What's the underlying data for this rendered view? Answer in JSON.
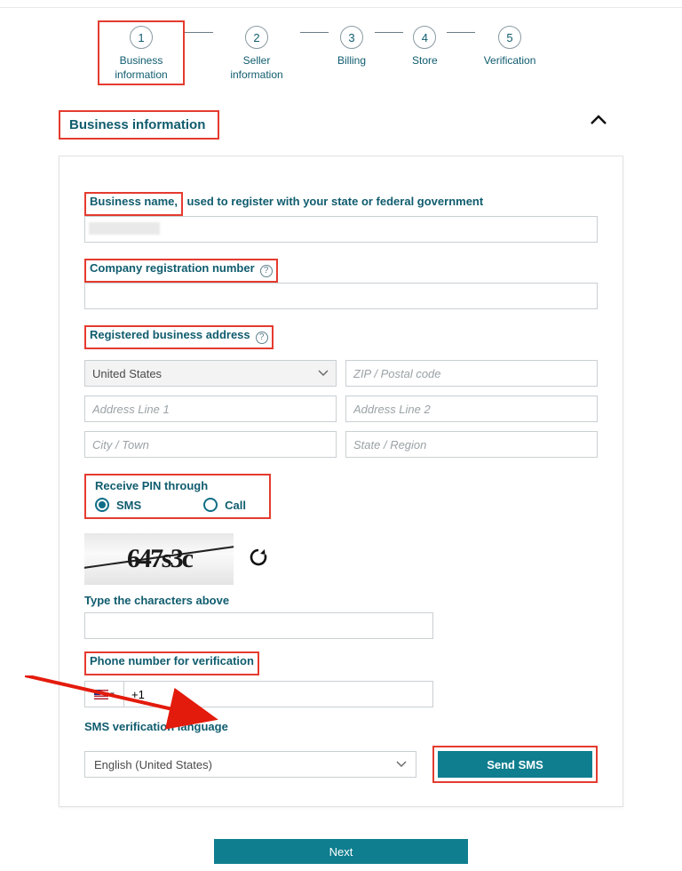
{
  "wizard": {
    "steps": [
      {
        "num": "1",
        "label": "Business information"
      },
      {
        "num": "2",
        "label": "Seller information"
      },
      {
        "num": "3",
        "label": "Billing"
      },
      {
        "num": "4",
        "label": "Store"
      },
      {
        "num": "5",
        "label": "Verification"
      }
    ]
  },
  "section_title": "Business information",
  "labels": {
    "business_name_boxed": "Business name,",
    "business_name_rest": " used to register with your state or federal government",
    "company_reg": "Company registration number",
    "reg_addr": "Registered business address",
    "captcha_prompt": "Type the characters above",
    "phone_verif": "Phone number for verification",
    "sms_lang": "SMS verification language"
  },
  "address": {
    "country": "United States",
    "placeholders": {
      "zip": "ZIP / Postal code",
      "line1": "Address Line 1",
      "line2": "Address Line 2",
      "city": "City / Town",
      "state": "State / Region"
    }
  },
  "pin": {
    "title": "Receive PIN through",
    "opts": {
      "sms": "SMS",
      "call": "Call"
    },
    "selected": "sms"
  },
  "captcha_text": "647s3c",
  "phone": {
    "prefix": "+1"
  },
  "language": "English (United States)",
  "buttons": {
    "send_sms": "Send SMS",
    "next": "Next"
  }
}
